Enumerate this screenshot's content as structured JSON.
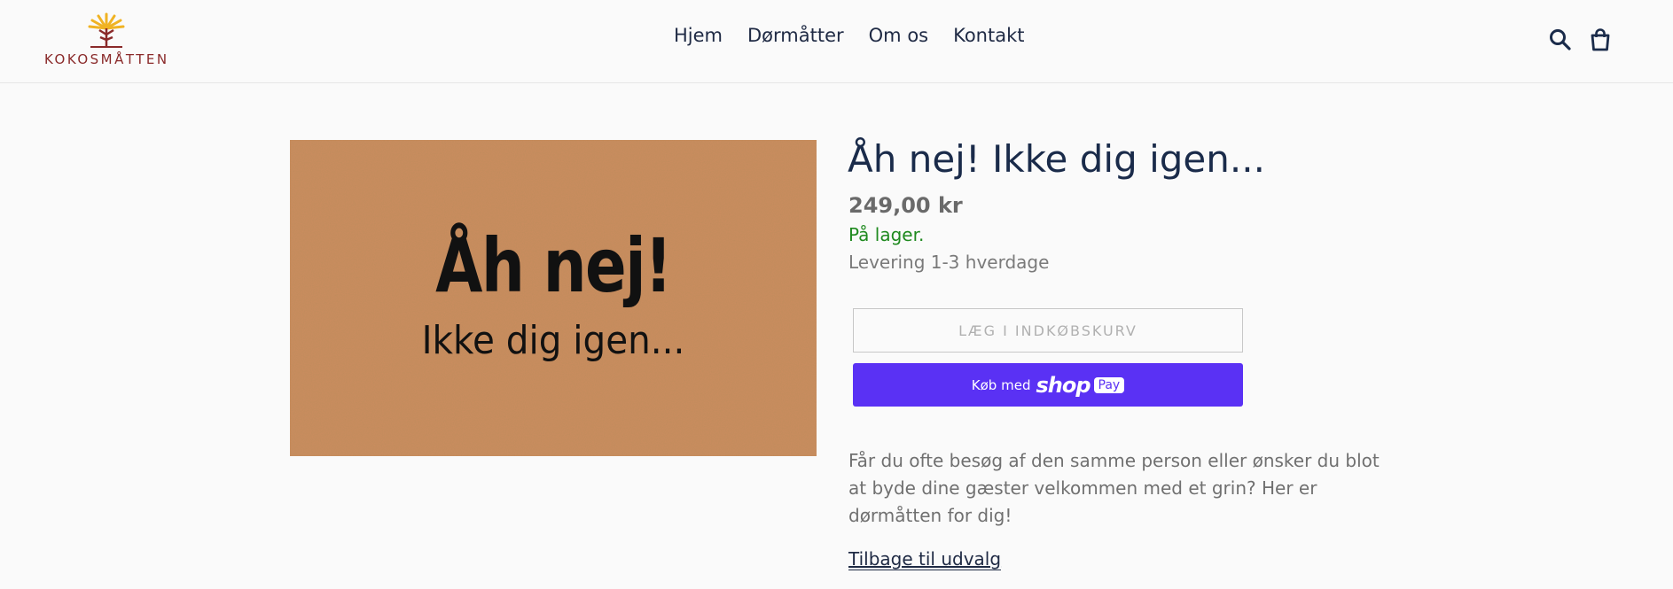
{
  "header": {
    "logo_text": "KOKOSMÅTTEN",
    "nav": [
      "Hjem",
      "Dørmåtter",
      "Om os",
      "Kontakt"
    ]
  },
  "product": {
    "image_text_line1": "Åh nej!",
    "image_text_line2": "Ikke dig igen...",
    "title": "Åh nej! Ikke dig igen...",
    "price": "249,00 kr",
    "stock": "På lager.",
    "delivery": "Levering 1-3 hverdage",
    "add_to_cart_label": "LÆG I INDKØBSKURV",
    "buy_prefix": "Køb med",
    "buy_brand": "shop",
    "buy_pay": "Pay",
    "description": "Får du ofte besøg af den samme person eller ønsker du blot at byde dine gæster velkommen med et grin? Her er dørmåtten for dig!",
    "back_link": "Tilbage til udvalg"
  },
  "colors": {
    "accent": "#5a31f4",
    "in_stock": "#1f8a1f",
    "nav_text": "#1f2a44"
  }
}
